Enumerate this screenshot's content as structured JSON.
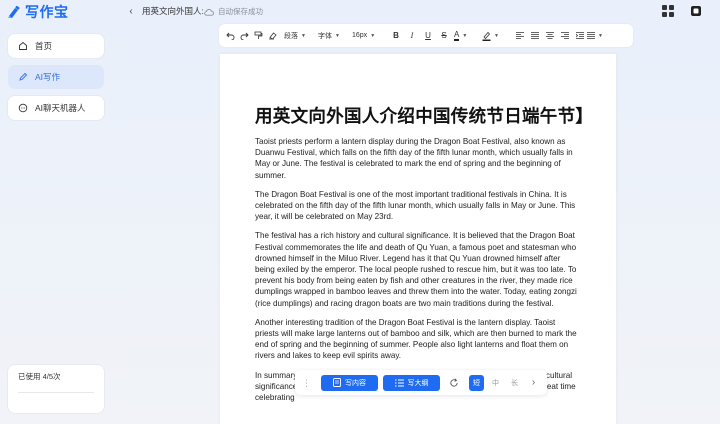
{
  "app": {
    "name": "写作宝",
    "brand_color": "#1e6cf2"
  },
  "header": {
    "doc_title": "用英文向外国人:",
    "save_status": "自动保存成功"
  },
  "sidebar": {
    "items": [
      {
        "label": "首页",
        "icon": "home-icon"
      },
      {
        "label": "AI写作",
        "icon": "pen-icon",
        "active": true
      },
      {
        "label": "AI聊天机器人",
        "icon": "chat-icon"
      }
    ],
    "usage": "已使用 4/5次"
  },
  "toolbar": {
    "paragraph": "段落",
    "font": "字体",
    "size": "16px",
    "bold": "B",
    "italic": "I",
    "underline": "U",
    "strike": "S",
    "font_color": "A"
  },
  "document": {
    "title": "用英文向外国人介绍中国传统节日端午节】",
    "paragraphs": [
      "Taoist priests perform a lantern display during the Dragon Boat Festival, also known as Duanwu Festival, which falls on the fifth day of the fifth lunar month, which usually falls in May or June. The festival is celebrated to mark the end of spring and the beginning of summer.",
      "The Dragon Boat Festival is one of the most important traditional festivals in China. It is celebrated on the fifth day of the fifth lunar month, which usually falls in May or June. This year, it will be celebrated on May 23rd.",
      "The festival has a rich history and cultural significance. It is believed that the Dragon Boat Festival commemorates the life and death of Qu Yuan, a famous poet and statesman who drowned himself in the Miluo River. Legend has it that Qu Yuan drowned himself after being exiled by the emperor. The local people rushed to rescue him, but it was too late. To prevent his body from being eaten by fish and other creatures in the river, they made rice dumplings wrapped in bamboo leaves and threw them into the water. Today, eating zongzi (rice dumplings) and racing dragon boats are two main traditions during the festival.",
      "Another interesting tradition of the Dragon Boat Festival is the lantern display. Taoist priests will make large lanterns out of bamboo and silk, which are then burned to mark the end of spring and the beginning of summer. People also light lanterns and float them on rivers and lakes to keep evil spirits away.",
      "In summary, the Dragon Boat Festival is a traditional festival with rich history and cultural significance. It is a time for family reunions, food, and fun. We hope you have a great time celebrating"
    ]
  },
  "floatbar": {
    "write_content": "写内容",
    "write_outline": "写大纲",
    "len_short": "短",
    "len_medium": "中",
    "len_long": "长"
  }
}
